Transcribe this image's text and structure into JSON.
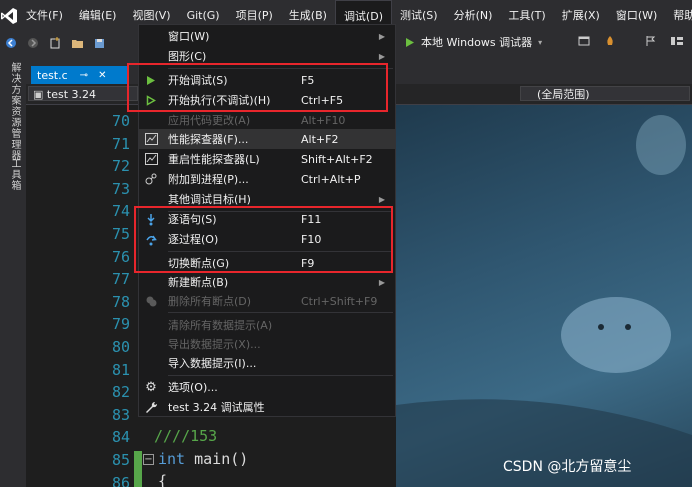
{
  "menubar": {
    "items": [
      {
        "label": "文件(F)"
      },
      {
        "label": "编辑(E)"
      },
      {
        "label": "视图(V)"
      },
      {
        "label": "Git(G)"
      },
      {
        "label": "项目(P)"
      },
      {
        "label": "生成(B)"
      },
      {
        "label": "调试(D)"
      },
      {
        "label": "测试(S)"
      },
      {
        "label": "分析(N)"
      },
      {
        "label": "工具(T)"
      },
      {
        "label": "扩展(X)"
      },
      {
        "label": "窗口(W)"
      },
      {
        "label": "帮助"
      }
    ]
  },
  "toolbar": {
    "run_target": "本地 Windows 调试器"
  },
  "sidebar": {
    "solution_explorer": "解决方案资源管理器",
    "toolbox": "工具箱"
  },
  "tab": {
    "name": "test.c",
    "pin": "⊸",
    "close": "✕"
  },
  "navbar": {
    "project": "test 3.24",
    "scope": "(全局范围)"
  },
  "editor": {
    "line_numbers": [
      "70",
      "71",
      "72",
      "73",
      "74",
      "75",
      "76",
      "77",
      "78",
      "79",
      "80",
      "81",
      "82",
      "83",
      "84",
      "85",
      "86"
    ],
    "code_84": "////153",
    "code_85_kw": "int",
    "code_85_rest": " main()",
    "code_86": "{"
  },
  "watermark": "CSDN @北方留意尘",
  "debug_menu": {
    "items": [
      {
        "label": "窗口(W)",
        "shortcut": "",
        "arrow": true,
        "icon": "",
        "disabled": false
      },
      {
        "label": "图形(C)",
        "shortcut": "",
        "arrow": true,
        "icon": "",
        "disabled": false
      },
      {
        "label": "开始调试(S)",
        "shortcut": "F5",
        "arrow": false,
        "icon": "play-icon",
        "disabled": false
      },
      {
        "label": "开始执行(不调试)(H)",
        "shortcut": "Ctrl+F5",
        "arrow": false,
        "icon": "play-outline-icon",
        "disabled": false
      },
      {
        "label": "应用代码更改(A)",
        "shortcut": "Alt+F10",
        "arrow": false,
        "icon": "",
        "disabled": true
      },
      {
        "label": "性能探查器(F)...",
        "shortcut": "Alt+F2",
        "arrow": false,
        "icon": "profiler-icon",
        "disabled": false
      },
      {
        "label": "重启性能探查器(L)",
        "shortcut": "Shift+Alt+F2",
        "arrow": false,
        "icon": "profiler-restart-icon",
        "disabled": false
      },
      {
        "label": "附加到进程(P)...",
        "shortcut": "Ctrl+Alt+P",
        "arrow": false,
        "icon": "attach-icon",
        "disabled": false
      },
      {
        "label": "其他调试目标(H)",
        "shortcut": "",
        "arrow": true,
        "icon": "",
        "disabled": false
      },
      {
        "label": "逐语句(S)",
        "shortcut": "F11",
        "arrow": false,
        "icon": "step-into-icon",
        "disabled": false
      },
      {
        "label": "逐过程(O)",
        "shortcut": "F10",
        "arrow": false,
        "icon": "step-over-icon",
        "disabled": false
      },
      {
        "label": "切换断点(G)",
        "shortcut": "F9",
        "arrow": false,
        "icon": "",
        "disabled": false
      },
      {
        "label": "新建断点(B)",
        "shortcut": "",
        "arrow": true,
        "icon": "",
        "disabled": false
      },
      {
        "label": "删除所有断点(D)",
        "shortcut": "Ctrl+Shift+F9",
        "arrow": false,
        "icon": "delete-breakpoints-icon",
        "disabled": true
      },
      {
        "label": "清除所有数据提示(A)",
        "shortcut": "",
        "arrow": false,
        "icon": "",
        "disabled": true
      },
      {
        "label": "导出数据提示(X)...",
        "shortcut": "",
        "arrow": false,
        "icon": "",
        "disabled": true
      },
      {
        "label": "导入数据提示(I)...",
        "shortcut": "",
        "arrow": false,
        "icon": "",
        "disabled": false
      },
      {
        "label": "选项(O)...",
        "shortcut": "",
        "arrow": false,
        "icon": "gear-icon",
        "disabled": false
      },
      {
        "label": "test 3.24 调试属性",
        "shortcut": "",
        "arrow": false,
        "icon": "wrench-icon",
        "disabled": false
      }
    ]
  },
  "colors": {
    "accent": "#007acc",
    "highlight_box": "#e8262c",
    "play_green": "#6cbf40"
  }
}
